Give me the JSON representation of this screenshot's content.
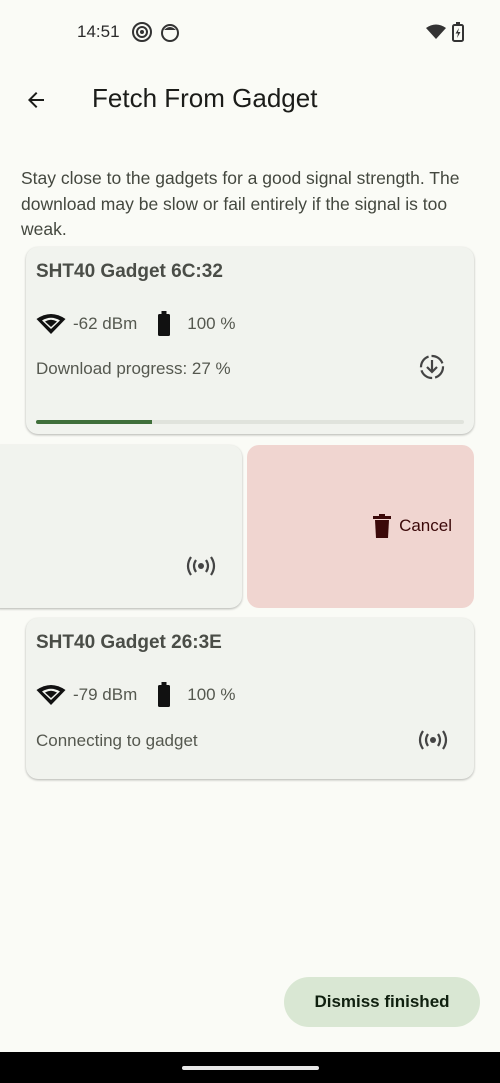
{
  "status_bar": {
    "time": "14:51"
  },
  "app_bar": {
    "title": "Fetch From Gadget"
  },
  "hint_text": "Stay close to the gadgets for a good signal strength. The download may be slow or fail entirely if the signal is too weak.",
  "gadgets": [
    {
      "name": "SHT40 Gadget 6C:32",
      "signal": "-62 dBm",
      "battery": "100 %",
      "status": "Download progress: 27 %",
      "progress": 0.27,
      "status_icon": "download-icon"
    },
    {
      "name": "",
      "signal": "",
      "battery": "",
      "status": "",
      "status_icon": "broadcast-icon",
      "swiped": true,
      "action_label": "Cancel",
      "action_icon": "trash-icon"
    },
    {
      "name": "SHT40 Gadget 26:3E",
      "signal": "-79 dBm",
      "battery": "100 %",
      "status": "Connecting to gadget",
      "status_icon": "broadcast-icon"
    }
  ],
  "fab": {
    "label": "Dismiss finished"
  },
  "colors": {
    "background": "#fafbf6",
    "card": "#f1f3ee",
    "progress": "#3f6f3a",
    "cancel_bg": "#f0d5d0",
    "fab_bg": "#d9e7d3"
  }
}
